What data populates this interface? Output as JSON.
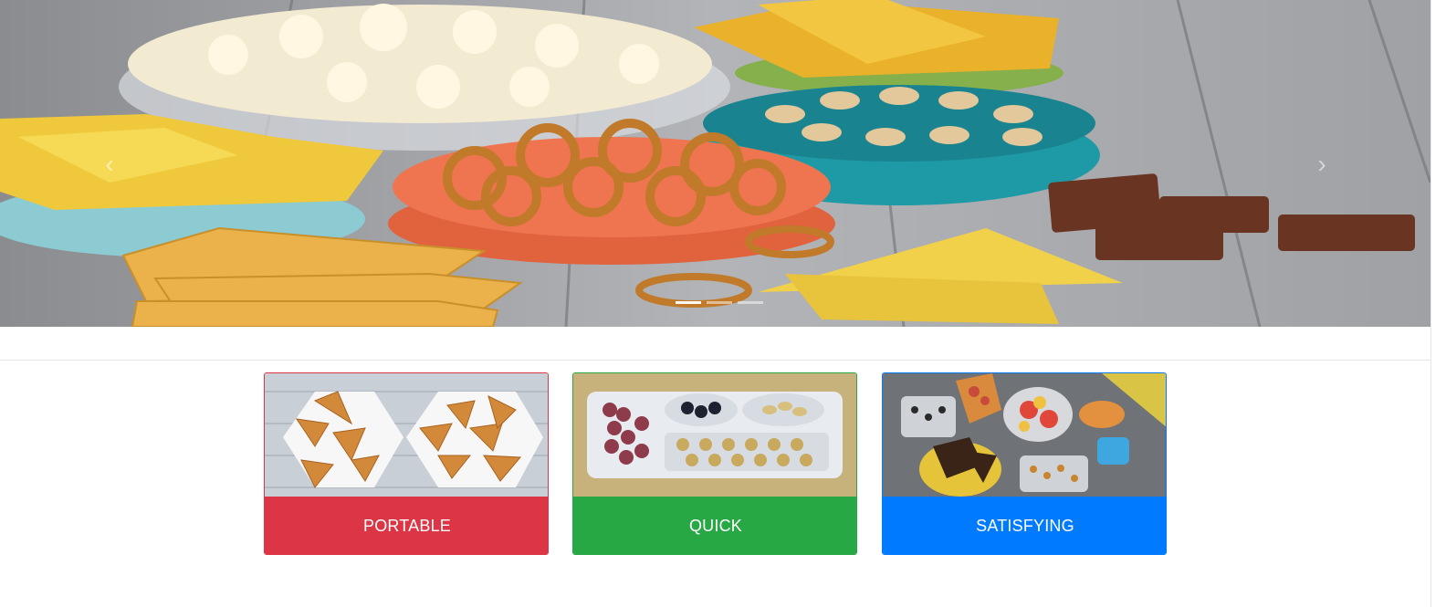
{
  "colors": {
    "portable": "#dc3545",
    "quick": "#28a745",
    "satisfying": "#007bff"
  },
  "hero": {
    "image": "snack-foods-assortment",
    "prev_icon": "chevron-left-icon",
    "next_icon": "chevron-right-icon",
    "prev_glyph": "‹",
    "next_glyph": "›"
  },
  "cards": [
    {
      "label": "PORTABLE",
      "image": "samosa-pastries-on-plates"
    },
    {
      "label": "QUICK",
      "image": "bento-snack-tray"
    },
    {
      "label": "SATISFYING",
      "image": "snack-containers-assortment"
    }
  ]
}
